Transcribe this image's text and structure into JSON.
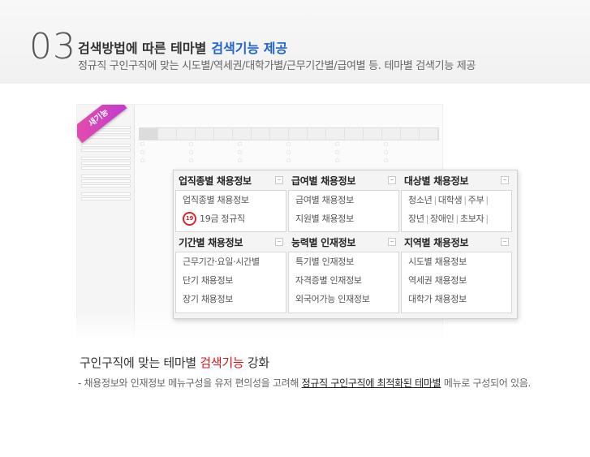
{
  "header": {
    "number": "03",
    "title": "검색방법에 따른 테마별",
    "title_highlight": "검색기능 제공",
    "subtitle": "정규직 구인구직에 맞는 시도별/역세권/대학가별/근무기간별/급여별 등.  테마별 검색기능 제공"
  },
  "badge": "새기능",
  "panel": {
    "industry": {
      "title": "업직종별 채용정보",
      "items": [
        "업직종별 채용정보",
        "19금 정규직"
      ],
      "circle": "19"
    },
    "salary": {
      "title": "급여별 채용정보",
      "items": [
        "급여별 채용정보",
        "지원별 채용정보"
      ]
    },
    "target": {
      "title": "대상별 채용정보",
      "row1": [
        "청소년",
        "대학생",
        "주부"
      ],
      "row2": [
        "장년",
        "장애인",
        "초보자"
      ]
    },
    "period": {
      "title": "기간별 채용정보",
      "items": [
        "근무기간·요일·시간별",
        "단기 채용정보",
        "장기 채용정보"
      ]
    },
    "ability": {
      "title": "능력별 인재정보",
      "items": [
        "특기별 인재정보",
        "자격증별 인재정보",
        "외국어가능 인재정보"
      ]
    },
    "region": {
      "title": "지역별 채용정보",
      "items": [
        "시도별 채용정보",
        "역세권 채용정보",
        "대학가 채용정보"
      ]
    }
  },
  "bottom": {
    "title_pre": "구인구직에 맞는 테마별 ",
    "title_red": "검색기능",
    "title_post": " 강화",
    "desc_pre": "- 채용정보와 인재정보 메뉴구성을 유저 편의성을 고려해 ",
    "desc_u": "정규직 구인구직에 최적화된 테마별",
    "desc_post": "  메뉴로 구성되어 있음."
  },
  "colors": {
    "accent_blue": "#1f63d3",
    "accent_red": "#e0151b",
    "badge": "#d044c0"
  }
}
